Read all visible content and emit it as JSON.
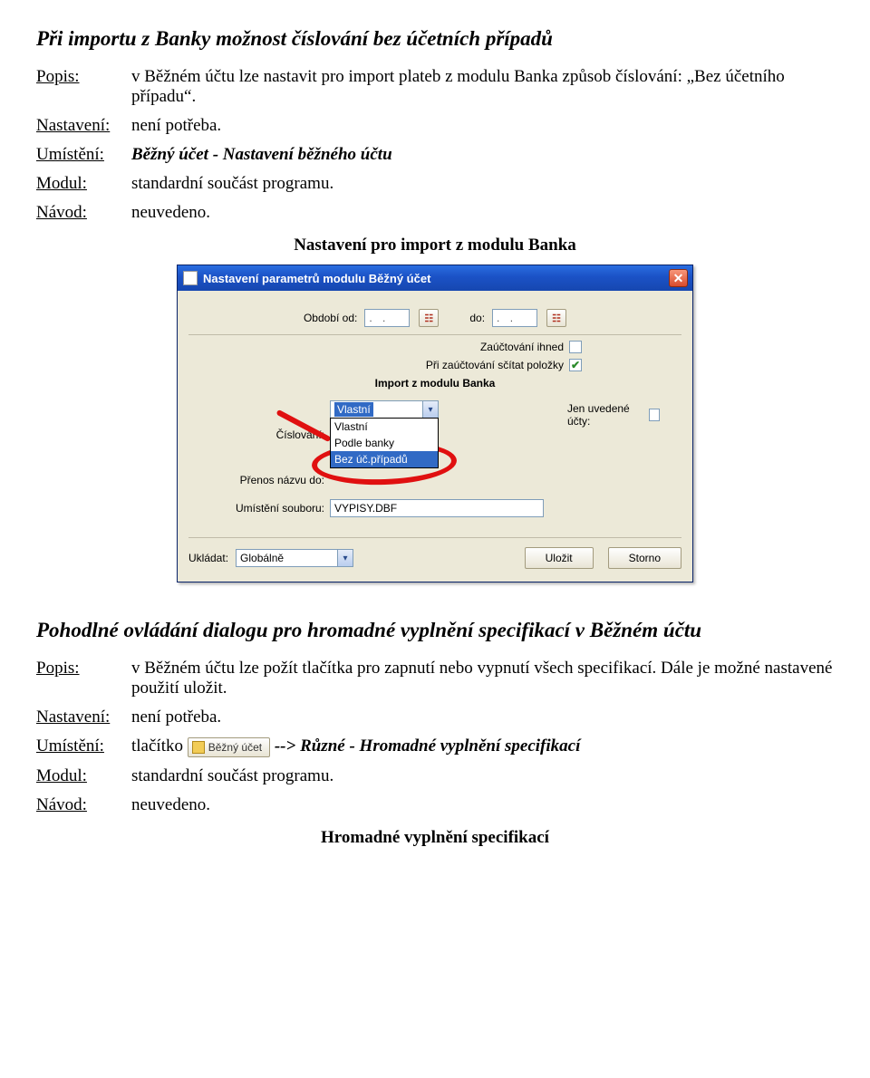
{
  "section1": {
    "title": "Při importu z Banky možnost číslování bez účetních případů",
    "popis_label": "Popis:",
    "popis_value": "v Běžném účtu lze nastavit pro import plateb z modulu Banka způsob číslování: „Bez účetního případu“.",
    "nastaveni_label": "Nastavení:",
    "nastaveni_value": "není potřeba.",
    "umisteni_label": "Umístění:",
    "umisteni_value": "Běžný účet - Nastavení běžného účtu",
    "modul_label": "Modul:",
    "modul_value": "standardní součást programu.",
    "navod_label": "Návod:",
    "navod_value": "neuvedeno.",
    "caption": "Nastavení pro import z modulu Banka"
  },
  "dialog": {
    "title": "Nastavení parametrů modulu Běžný účet",
    "obdobi_od_label": "Období od:",
    "obdobi_od_value": ". .",
    "obdobi_do_label": "do:",
    "obdobi_do_value": ". .",
    "ihned_label": "Zaúčtování ihned",
    "ihned_checked": false,
    "scitat_label": "Při zaúčtování sčítat položky",
    "scitat_checked": true,
    "import_head": "Import z modulu Banka",
    "cislovani_label": "Číslování:",
    "cislovani_selected": "Vlastní",
    "cislovani_options": [
      "Vlastní",
      "Podle banky",
      "Bez úč.případů"
    ],
    "cislovani_highlight_index": 2,
    "jen_ucty_label": "Jen uvedené účty:",
    "jen_ucty_checked": false,
    "prenos_label": "Přenos názvu do:",
    "umisteni_label": "Umístění souboru:",
    "umisteni_value": "VYPISY.DBF",
    "ukladat_label": "Ukládat:",
    "ukladat_value": "Globálně",
    "save_btn": "Uložit",
    "cancel_btn": "Storno"
  },
  "section2": {
    "title": "Pohodlné ovládání dialogu pro hromadné vyplnění specifikací v Běžném účtu",
    "popis_label": "Popis:",
    "popis_value": "v Běžném účtu lze požít tlačítka pro zapnutí nebo vypnutí všech specifikací. Dále je možné nastavené použití uložit.",
    "nastaveni_label": "Nastavení:",
    "nastaveni_value": "není potřeba.",
    "umisteni_label": "Umístění:",
    "umisteni_prefix": "tlačítko",
    "umisteni_icon_label": "Běžný účet",
    "umisteni_suffix": "--> Různé - Hromadné vyplnění specifikací",
    "modul_label": "Modul:",
    "modul_value": "standardní součást programu.",
    "navod_label": "Návod:",
    "navod_value": "neuvedeno.",
    "caption": "Hromadné vyplnění specifikací"
  }
}
